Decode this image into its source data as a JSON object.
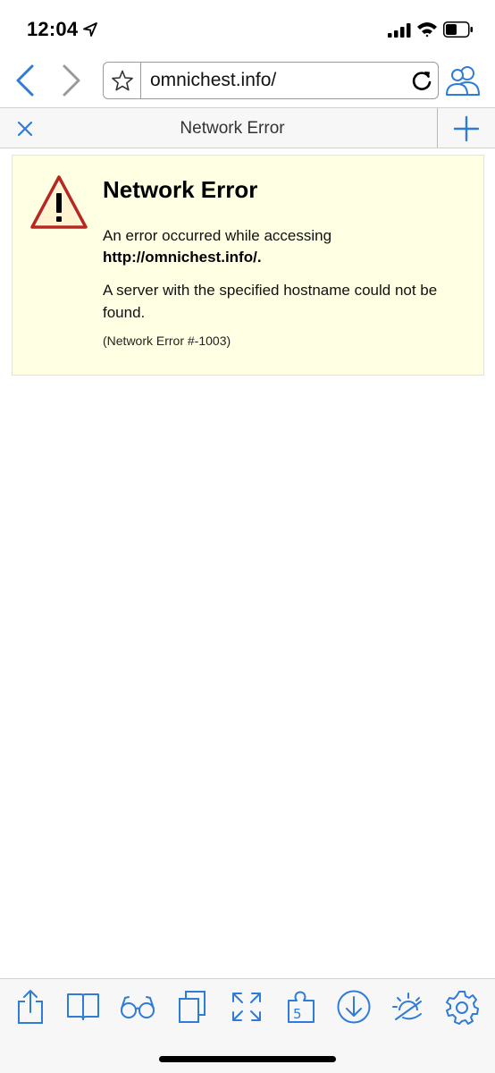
{
  "status_bar": {
    "time": "12:04"
  },
  "nav": {
    "url": "omnichest.info/"
  },
  "tab": {
    "title": "Network Error"
  },
  "error": {
    "title": "Network Error",
    "line1": "An error occurred while accessing",
    "url": "http://omnichest.info/.",
    "detail": "A server with the specified hostname could not be found.",
    "code": "(Network Error #-1003)"
  },
  "colors": {
    "accent": "#2f7bd8",
    "panel_bg": "#ffffe3",
    "warning_red": "#b8281d"
  },
  "toolbar": {
    "icons": [
      "share-icon",
      "bookmarks-icon",
      "reader-glasses-icon",
      "tabs-icon",
      "fullscreen-icon",
      "extensions-icon",
      "downloads-icon",
      "night-mode-icon",
      "settings-icon"
    ]
  }
}
